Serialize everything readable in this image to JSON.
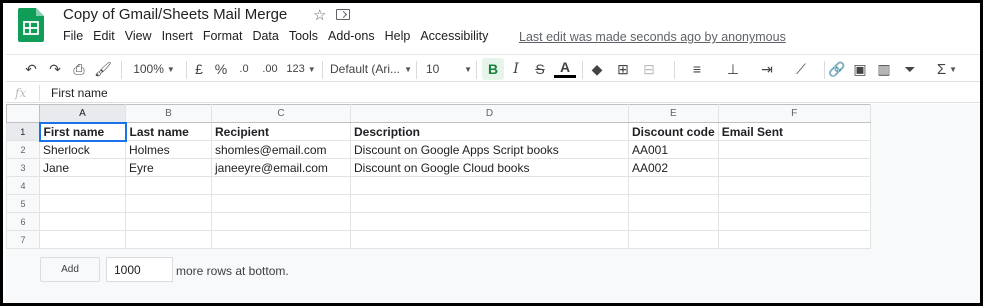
{
  "header": {
    "title": "Copy of Gmail/Sheets Mail Merge",
    "last_edit": "Last edit was made seconds ago by anonymous"
  },
  "menu": [
    "File",
    "Edit",
    "View",
    "Insert",
    "Format",
    "Data",
    "Tools",
    "Add-ons",
    "Help",
    "Accessibility"
  ],
  "toolbar": {
    "zoom": "100%",
    "currency": "£",
    "percent": "%",
    "dec_decrease": ".0",
    "dec_increase": ".00",
    "more_formats": "123",
    "font": "Default (Ari...",
    "font_size": "10",
    "bold": "B",
    "italic": "I",
    "strikethrough": "S",
    "text_color": "A",
    "sum": "Σ"
  },
  "formula_bar": {
    "fx": "fx",
    "value": "First name"
  },
  "grid": {
    "columns": [
      "A",
      "B",
      "C",
      "D",
      "E",
      "F"
    ],
    "row_numbers": [
      "1",
      "2",
      "3",
      "4",
      "5",
      "6",
      "7"
    ],
    "rows": [
      [
        "First name",
        "Last name",
        "Recipient",
        "Description",
        "Discount code",
        "Email Sent"
      ],
      [
        "Sherlock",
        "Holmes",
        "shomles@email.com",
        "Discount on Google Apps Script books",
        "AA001",
        ""
      ],
      [
        "Jane",
        "Eyre",
        "janeeyre@email.com",
        "Discount on Google Cloud books",
        "AA002",
        ""
      ],
      [
        "",
        "",
        "",
        "",
        "",
        ""
      ],
      [
        "",
        "",
        "",
        "",
        "",
        ""
      ],
      [
        "",
        "",
        "",
        "",
        "",
        ""
      ],
      [
        "",
        "",
        "",
        "",
        "",
        ""
      ]
    ]
  },
  "footer": {
    "add_label": "Add",
    "rows_value": "1000",
    "more_rows_label": "more rows at bottom."
  },
  "colors": {
    "brand_green": "#0f9d58",
    "selection_blue": "#1a73e8"
  }
}
